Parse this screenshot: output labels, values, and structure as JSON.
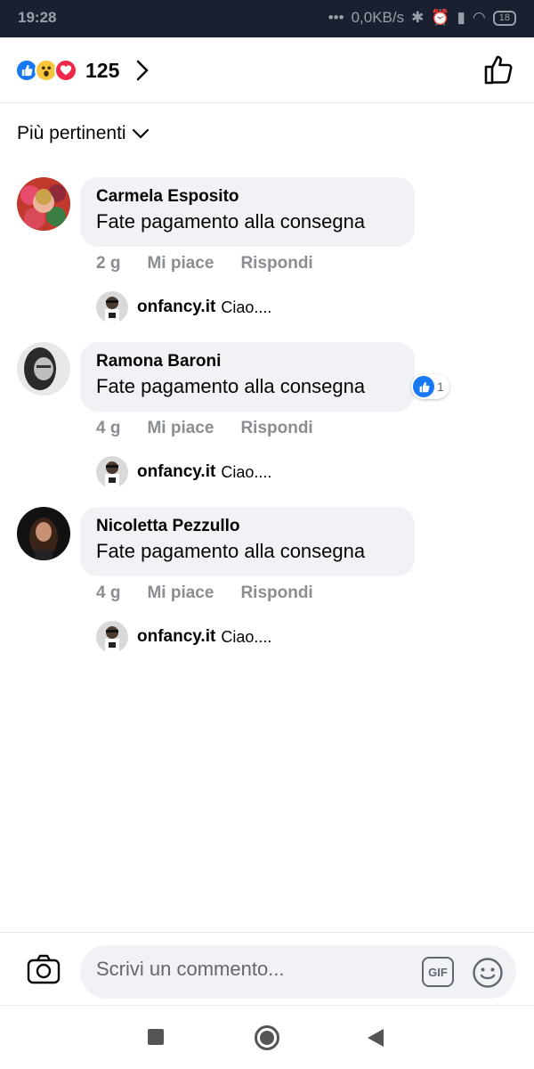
{
  "status_bar": {
    "time": "19:28",
    "network_speed": "0,0KB/s",
    "battery": "18"
  },
  "reactions": {
    "count": "125",
    "icons": [
      "like-icon",
      "wow-icon",
      "love-icon"
    ]
  },
  "sort": {
    "label": "Più pertinenti"
  },
  "comments": [
    {
      "author": "Carmela Esposito",
      "text": "Fate pagamento alla consegna",
      "time": "2 g",
      "like_label": "Mi piace",
      "reply_label": "Rispondi",
      "reply": {
        "author": "onfancy.it",
        "text": "Ciao...."
      }
    },
    {
      "author": "Ramona Baroni",
      "text": "Fate pagamento alla consegna",
      "time": "4 g",
      "like_label": "Mi piace",
      "reply_label": "Rispondi",
      "reaction_count": "1",
      "reply": {
        "author": "onfancy.it",
        "text": "Ciao...."
      }
    },
    {
      "author": "Nicoletta Pezzullo",
      "text": "Fate pagamento alla consegna",
      "time": "4 g",
      "like_label": "Mi piace",
      "reply_label": "Rispondi",
      "reply": {
        "author": "onfancy.it",
        "text": "Ciao...."
      }
    }
  ],
  "composer": {
    "placeholder": "Scrivi un commento...",
    "gif_label": "GIF"
  },
  "colors": {
    "accent": "#1877f2",
    "bubble": "#f0f2f5",
    "muted": "#8a8d91"
  }
}
